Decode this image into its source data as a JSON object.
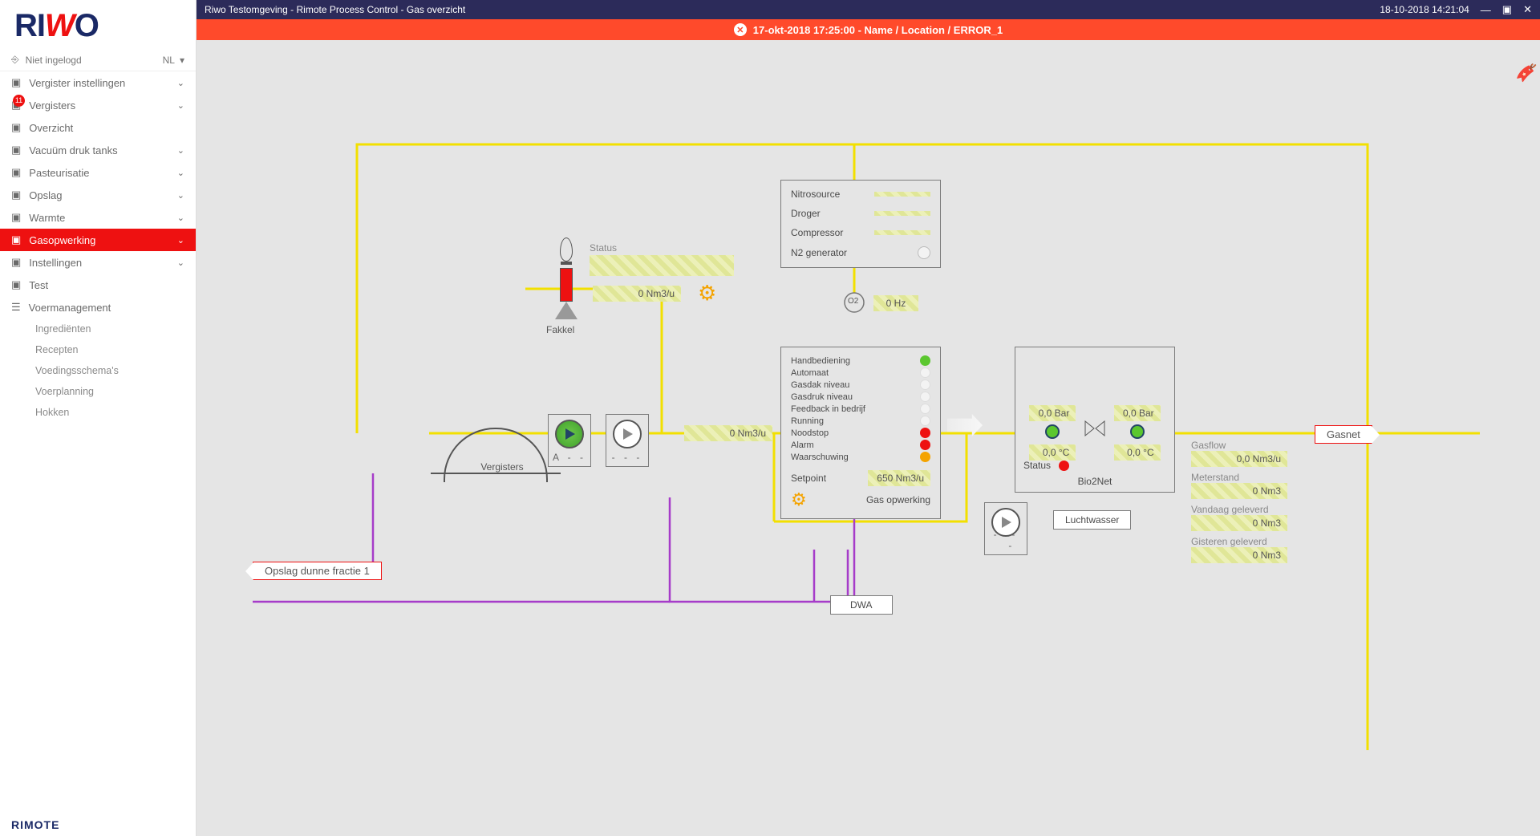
{
  "titlebar": {
    "text": "Riwo Testomgeving - Rimote Process Control - Gas overzicht",
    "datetime": "18-10-2018 14:21:04"
  },
  "alert": {
    "text": "17-okt-2018 17:25:00  - Name / Location / ERROR_1"
  },
  "sidebar": {
    "logo": "RIWO",
    "user": "Niet ingelogd",
    "lang": "NL",
    "badge": "11",
    "items": [
      {
        "label": "Vergister instellingen",
        "chev": true
      },
      {
        "label": "Vergisters",
        "chev": true,
        "badge": true
      },
      {
        "label": "Overzicht"
      },
      {
        "label": "Vacuüm druk tanks",
        "chev": true
      },
      {
        "label": "Pasteurisatie",
        "chev": true
      },
      {
        "label": "Opslag",
        "chev": true
      },
      {
        "label": "Warmte",
        "chev": true
      },
      {
        "label": "Gasopwerking",
        "chev": true,
        "active": true
      },
      {
        "label": "Instellingen",
        "chev": true
      },
      {
        "label": "Test"
      },
      {
        "label": "Voermanagement"
      }
    ],
    "subs": [
      {
        "label": "Ingrediënten"
      },
      {
        "label": "Recepten"
      },
      {
        "label": "Voedingsschema's"
      },
      {
        "label": "Voerplanning"
      },
      {
        "label": "Hokken"
      }
    ],
    "bottom": "RIMOTE"
  },
  "diagram": {
    "fakkel_label": "Fakkel",
    "fakkel_status_label": "Status",
    "fakkel_flow": "0  Nm3/u",
    "vergisters_label": "Vergisters",
    "pump_a": "A  -    -",
    "pump_b": "-    -    -",
    "main_flow": "0  Nm3/u",
    "opslag_label": "Opslag dunne fractie 1",
    "upper_panel": {
      "nitro": "Nitrosource",
      "droger": "Droger",
      "compressor": "Compressor",
      "n2": "N2 generator"
    },
    "o2_label": "O2",
    "hz": "0  Hz",
    "gasopwerking": {
      "title": "Gas opwerking",
      "rows": [
        {
          "label": "Handbediening",
          "led": "green"
        },
        {
          "label": "Automaat",
          "led": "off"
        },
        {
          "label": "Gasdak niveau",
          "led": "off"
        },
        {
          "label": "Gasdruk niveau",
          "led": "off"
        },
        {
          "label": "Feedback in bedrijf",
          "led": "off"
        },
        {
          "label": "Running",
          "led": "off"
        },
        {
          "label": "Noodstop",
          "led": "red"
        },
        {
          "label": "Alarm",
          "led": "red"
        },
        {
          "label": "Waarschuwing",
          "led": "orange"
        }
      ],
      "setpoint_label": "Setpoint",
      "setpoint": "650  Nm3/u"
    },
    "bio2net": {
      "title": "Bio2Net",
      "bar1": "0,0  Bar",
      "bar2": "0,0  Bar",
      "c1": "0,0  °C",
      "c2": "0,0  °C",
      "status_label": "Status"
    },
    "luchtwasser": "Luchtwasser",
    "dwa": "DWA",
    "gasnet": "Gasnet",
    "stats": {
      "gasflow_l": "Gasflow",
      "gasflow": "0,0  Nm3/u",
      "meter_l": "Meterstand",
      "meter": "0  Nm3",
      "vand_l": "Vandaag geleverd",
      "vand": "0  Nm3",
      "gist_l": "Gisteren geleverd",
      "gist": "0  Nm3"
    }
  }
}
